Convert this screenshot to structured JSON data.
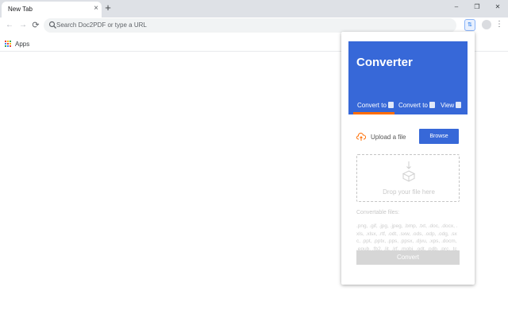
{
  "browser": {
    "tab": {
      "title": "New Tab",
      "close": "×"
    },
    "new_tab_symbol": "+",
    "window_controls": [
      "–",
      "❐",
      "✕"
    ],
    "nav": {
      "back": "←",
      "forward": "→",
      "reload": "⟳"
    },
    "omnibox": {
      "placeholder": "Search Doc2PDF or type a URL"
    },
    "extension_label": "⇅",
    "menu_symbol": "⋮",
    "bookmarks": {
      "apps_label": "Apps"
    },
    "apps_colors": [
      "#ea4335",
      "#fbbc04",
      "#34a853",
      "#4285f4",
      "#ea4335",
      "#fbbc04",
      "#34a853",
      "#4285f4",
      "#ea4335"
    ]
  },
  "popup": {
    "title": "Converter",
    "tabs": [
      {
        "label": "Convert to"
      },
      {
        "label": "Convert to"
      },
      {
        "label": "View"
      }
    ],
    "upload_label": "Upload a file",
    "browse_label": "Browse",
    "drop_label": "Drop your file here",
    "convertable_label": "Convertable files:",
    "formats": ".png, .gif, .jpg, .jpeg, .bmp, .txt, .doc, .docx, .xls, .xlsx, .rtf, .odt, .sxw, .ods, .odp, .odg, .sxc, .ppt, .pptx, .pps, .ppsx, .djvu, .xps, .docm, .epub, .fb2, .lit, .lrf, .mobi, .odt, .pdb, .prc, .tcr, .rtf, .htm, .html",
    "convert_label": "Convert",
    "colors": {
      "primary": "#3768d8",
      "accent": "#ff6d00",
      "disabled": "#d6d6d6"
    }
  }
}
